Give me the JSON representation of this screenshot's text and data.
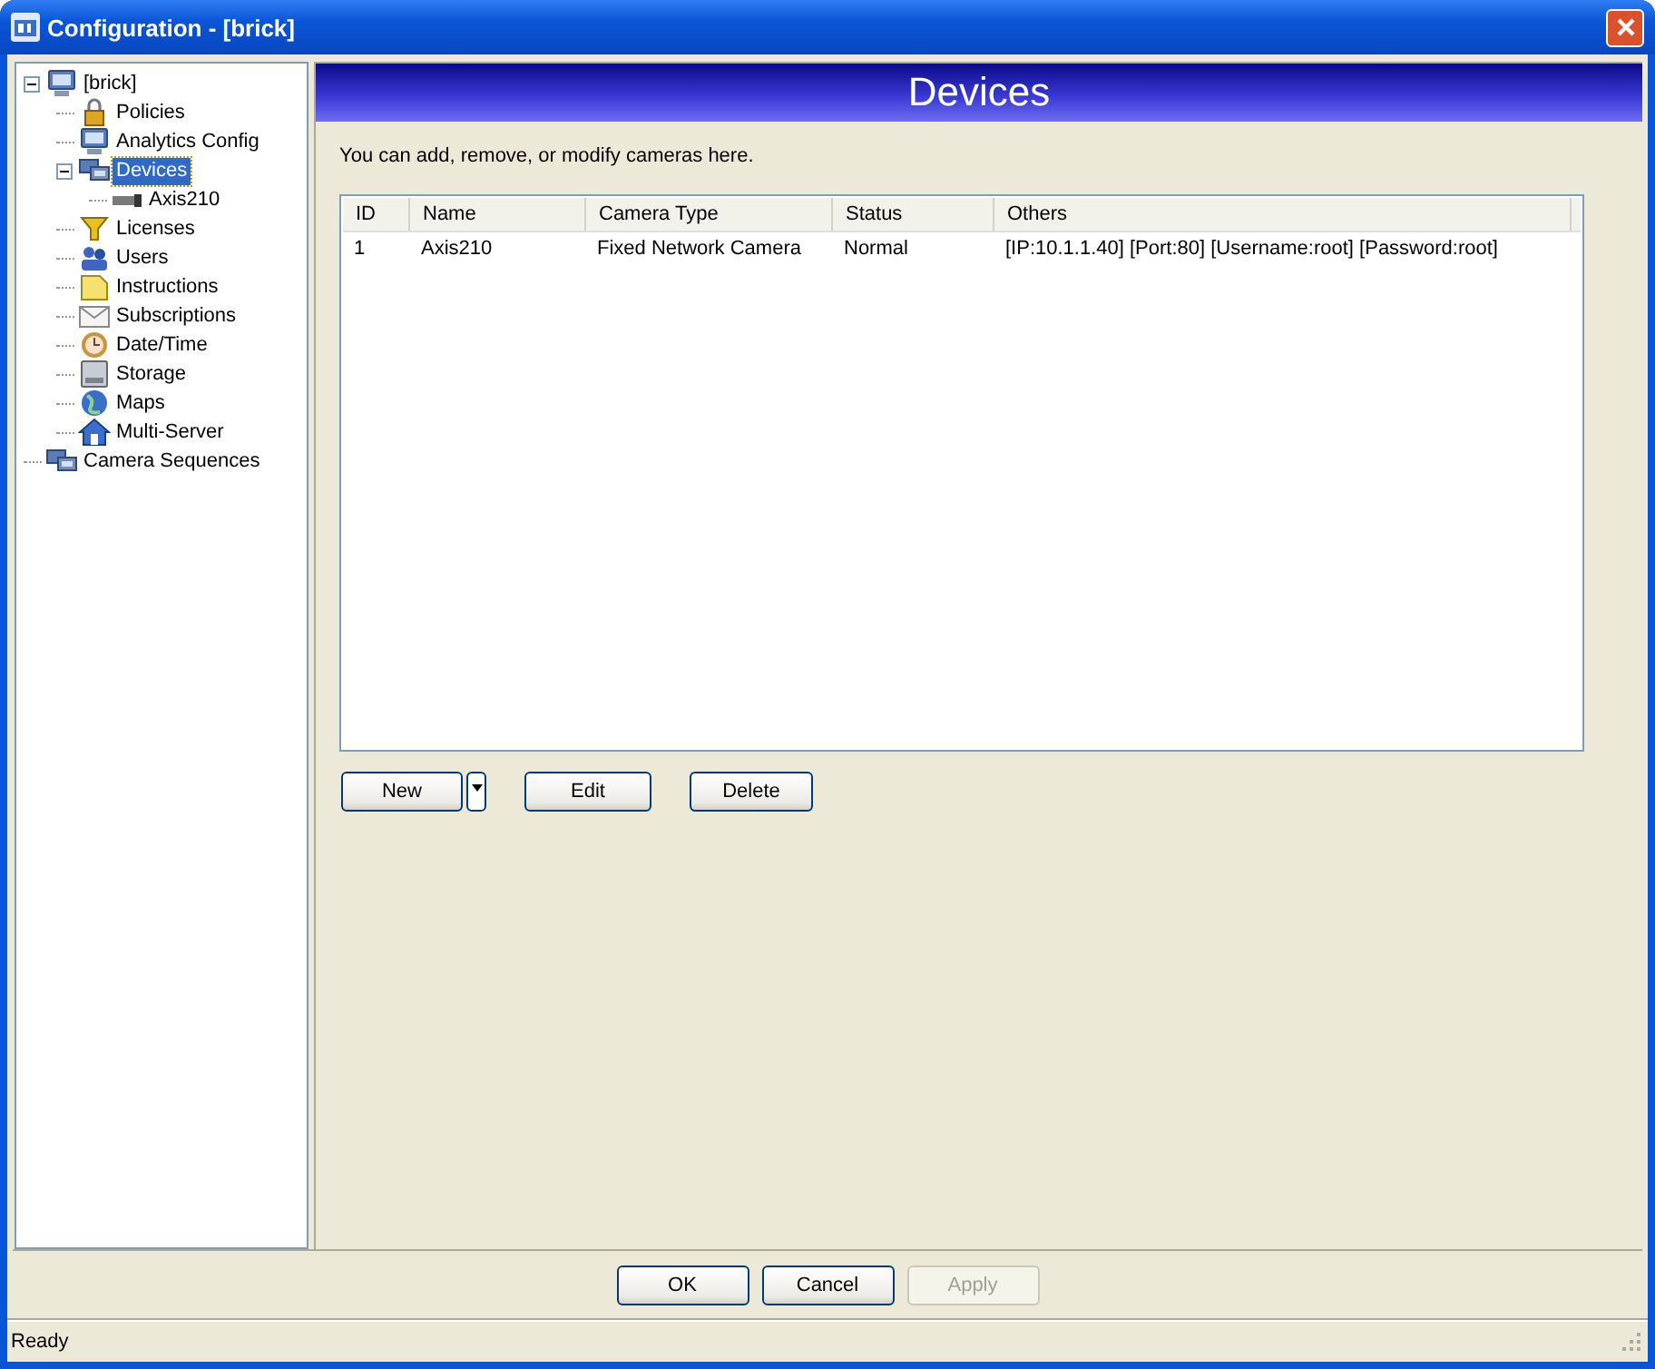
{
  "window": {
    "title": "Configuration - [brick]"
  },
  "tree": [
    {
      "label": "[brick]",
      "selected": false,
      "expanded": true,
      "children": [
        {
          "label": "Policies",
          "selected": false
        },
        {
          "label": "Analytics Config",
          "selected": false
        },
        {
          "label": "Devices",
          "selected": true,
          "expanded": true,
          "children": [
            {
              "label": "Axis210",
              "selected": false
            }
          ]
        },
        {
          "label": "Licenses",
          "selected": false
        },
        {
          "label": "Users",
          "selected": false
        },
        {
          "label": "Instructions",
          "selected": false
        },
        {
          "label": "Subscriptions",
          "selected": false
        },
        {
          "label": "Date/Time",
          "selected": false
        },
        {
          "label": "Storage",
          "selected": false
        },
        {
          "label": "Maps",
          "selected": false
        },
        {
          "label": "Multi-Server",
          "selected": false
        }
      ]
    },
    {
      "label": "Camera Sequences",
      "selected": false
    }
  ],
  "panel": {
    "title": "Devices",
    "description": "You can add, remove, or modify cameras here."
  },
  "table": {
    "columns": [
      "ID",
      "Name",
      "Camera Type",
      "Status",
      "Others"
    ],
    "rows": [
      [
        "1",
        "Axis210",
        "Fixed Network Camera",
        "Normal",
        "[IP:10.1.1.40] [Port:80] [Username:root] [Password:root]"
      ]
    ]
  },
  "actions": [
    {
      "label": "New",
      "kind": "split"
    },
    {
      "label": "Edit",
      "kind": "plain"
    },
    {
      "label": "Delete",
      "kind": "plain"
    }
  ],
  "dialog_buttons": [
    {
      "label": "OK",
      "disabled": false
    },
    {
      "label": "Cancel",
      "disabled": false
    },
    {
      "label": "Apply",
      "disabled": true
    }
  ],
  "status_bar": "Ready"
}
